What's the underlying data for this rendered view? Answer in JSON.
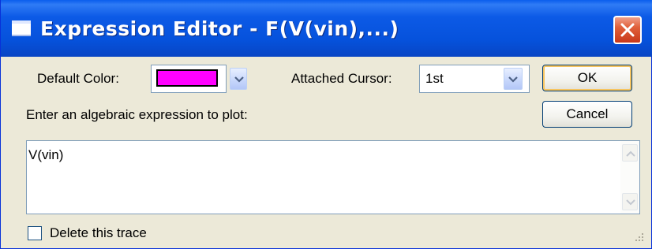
{
  "window": {
    "title": "Expression Editor - F(V(vin),...)"
  },
  "default_color": {
    "label": "Default Color:",
    "value_color": "#ff00ff"
  },
  "attached_cursor": {
    "label": "Attached Cursor:",
    "value": "1st"
  },
  "buttons": {
    "ok": "OK",
    "cancel": "Cancel"
  },
  "expression": {
    "prompt": "Enter an algebraic expression to plot:",
    "value": "V(vin)"
  },
  "delete_trace": {
    "label": "Delete this trace",
    "checked": false
  },
  "colors": {
    "titlebar": "#0652dc",
    "dialog_bg": "#ece9d8",
    "close_button": "#e0603a"
  },
  "icons": [
    "window-icon",
    "close-icon",
    "chevron-down-icon",
    "scroll-up-icon",
    "scroll-down-icon",
    "resize-grip-icon"
  ]
}
